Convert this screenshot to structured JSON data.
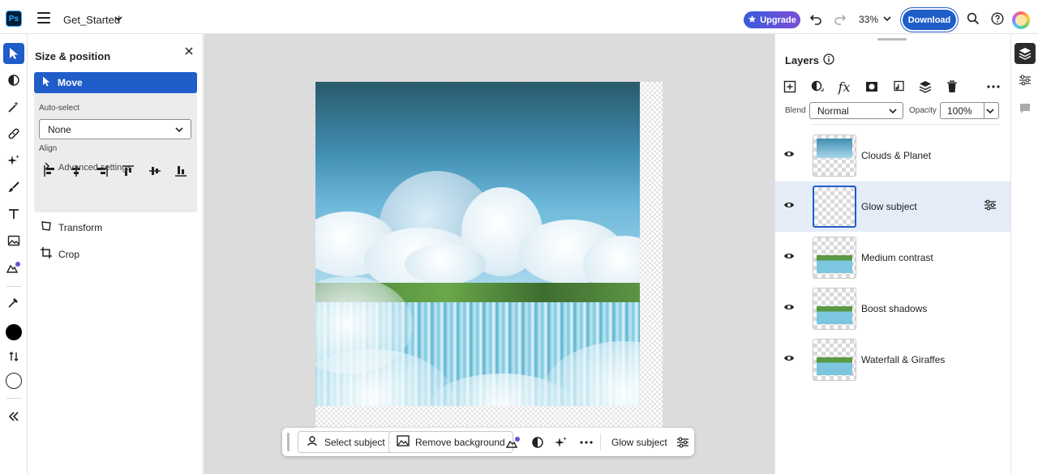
{
  "app": {
    "logo_text": "Ps",
    "document_title": "Get_Started",
    "upgrade_label": "Upgrade",
    "zoom_level": "33%",
    "download_label": "Download"
  },
  "colors": {
    "accent": "#1f5dc9",
    "upgrade_gradient_start": "#3a5bdc",
    "upgrade_gradient_end": "#7b4fd8"
  },
  "toolbar": {
    "tools": [
      "move-icon",
      "adjust-icon",
      "magic-wand-icon",
      "healing-icon",
      "generative-icon",
      "brush-icon",
      "type-icon",
      "image-icon",
      "generate-image-icon",
      "eyedropper-icon",
      "foreground-color",
      "swap-colors-icon",
      "background-color",
      "collapse-icon"
    ],
    "foreground_color": "#000000",
    "background_color": "#ffffff"
  },
  "props": {
    "title": "Size & position",
    "move_label": "Move",
    "autoselect_label": "Auto-select",
    "autoselect_value": "None",
    "align_label": "Align",
    "advanced_label": "Advanced settings",
    "transform_label": "Transform",
    "crop_label": "Crop"
  },
  "context_bar": {
    "select_subject": "Select subject",
    "remove_background": "Remove background",
    "layer_label": "Glow subject"
  },
  "layers": {
    "title": "Layers",
    "blend_label": "Blend",
    "blend_value": "Normal",
    "opacity_label": "Opacity",
    "opacity_value": "100%",
    "items": [
      {
        "name": "Clouds & Planet",
        "visible": true,
        "selected": false
      },
      {
        "name": "Glow subject",
        "visible": true,
        "selected": true
      },
      {
        "name": "Medium contrast",
        "visible": true,
        "selected": false
      },
      {
        "name": "Boost shadows",
        "visible": true,
        "selected": false
      },
      {
        "name": "Waterfall & Giraffes",
        "visible": true,
        "selected": false
      }
    ]
  }
}
